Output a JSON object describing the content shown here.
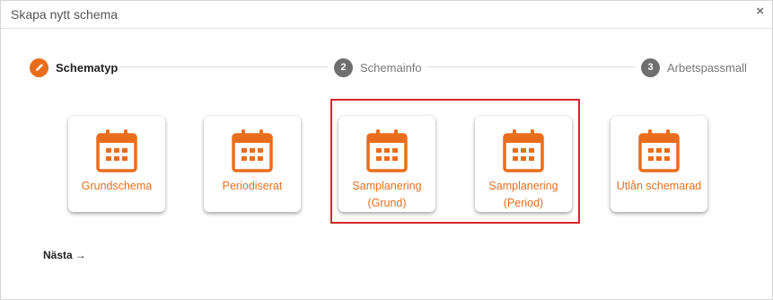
{
  "dialog": {
    "title": "Skapa nytt schema",
    "close": "×"
  },
  "stepper": {
    "steps": [
      {
        "number": "1",
        "label": "Schematyp",
        "active": true,
        "icon": "pencil-icon"
      },
      {
        "number": "2",
        "label": "Schemainfo",
        "active": false
      },
      {
        "number": "3",
        "label": "Arbetspassmall",
        "active": false
      }
    ]
  },
  "cards": [
    {
      "line1": "Grundschema",
      "line2": "",
      "icon": "calendar-icon"
    },
    {
      "line1": "Periodiserat",
      "line2": "",
      "icon": "calendar-icon"
    },
    {
      "line1": "Samplanering",
      "line2": "(Grund)",
      "icon": "calendar-icon"
    },
    {
      "line1": "Samplanering",
      "line2": "(Period)",
      "icon": "calendar-icon"
    },
    {
      "line1": "Utlån schemarad",
      "line2": "",
      "icon": "calendar-icon"
    }
  ],
  "footer": {
    "next_label": "Nästa",
    "next_arrow": "→"
  },
  "colors": {
    "accent": "#ea6d1b",
    "highlight": "#d8262c",
    "step_inactive": "#6f6f6f"
  }
}
